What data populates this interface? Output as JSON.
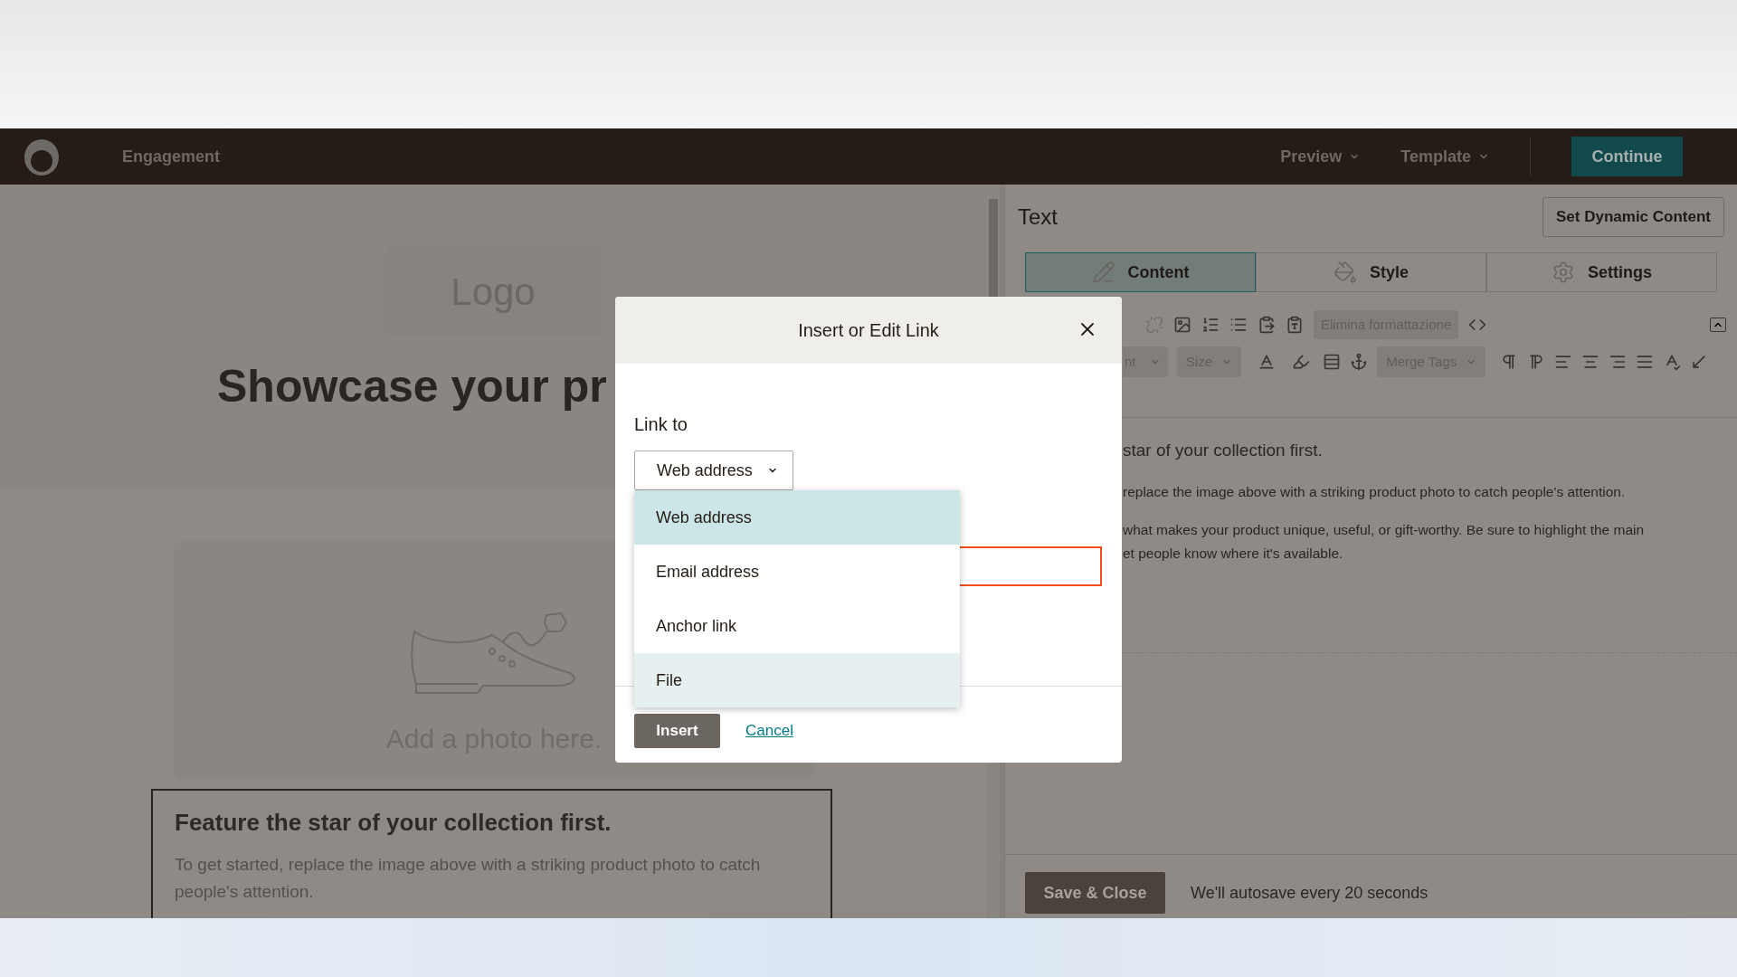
{
  "header": {
    "section": "Engagement",
    "menus": [
      {
        "label": "Preview"
      },
      {
        "label": "Template"
      }
    ],
    "primary_button": "Continue"
  },
  "canvas": {
    "logo_placeholder": "Logo",
    "heading": "Showcase your pr",
    "photo_placeholder": "Add a photo here.",
    "text_block": {
      "heading": "Feature the star of your collection first.",
      "body": "To get started, replace the image above with a striking product photo to catch people's attention."
    }
  },
  "panel": {
    "title": "Text",
    "dynamic_button": "Set Dynamic Content",
    "tabs": [
      {
        "label": "Content",
        "selected": true
      },
      {
        "label": "Style",
        "selected": false
      },
      {
        "label": "Settings",
        "selected": false
      }
    ],
    "toolbar": {
      "clear_format": "Elimina formattazione",
      "font": "nt",
      "size": "Size",
      "merge_tags": "Merge Tags"
    },
    "editor_lines": [
      {
        "kind": "heading",
        "text": "star of your collection first."
      },
      {
        "kind": "paragraph",
        "text": "replace the image above with a striking product photo to catch people's attention."
      },
      {
        "kind": "paragraph",
        "text": "what makes your product unique, useful, or gift-worthy. Be sure to highlight the main"
      },
      {
        "kind": "continuation",
        "text": "et people know where it's available."
      }
    ],
    "save_button": "Save & Close",
    "autosave_note": "We'll autosave every 20 seconds"
  },
  "dialog": {
    "title": "Insert or Edit Link",
    "link_to_label": "Link to",
    "select_value": "Web address",
    "url_field": {
      "invalid": true
    },
    "options": [
      {
        "label": "Web address",
        "selected": true,
        "hovered": false
      },
      {
        "label": "Email address",
        "selected": false,
        "hovered": false
      },
      {
        "label": "Anchor link",
        "selected": false,
        "hovered": false
      },
      {
        "label": "File",
        "selected": false,
        "hovered": true
      }
    ],
    "insert_button": "Insert",
    "cancel_link": "Cancel"
  }
}
